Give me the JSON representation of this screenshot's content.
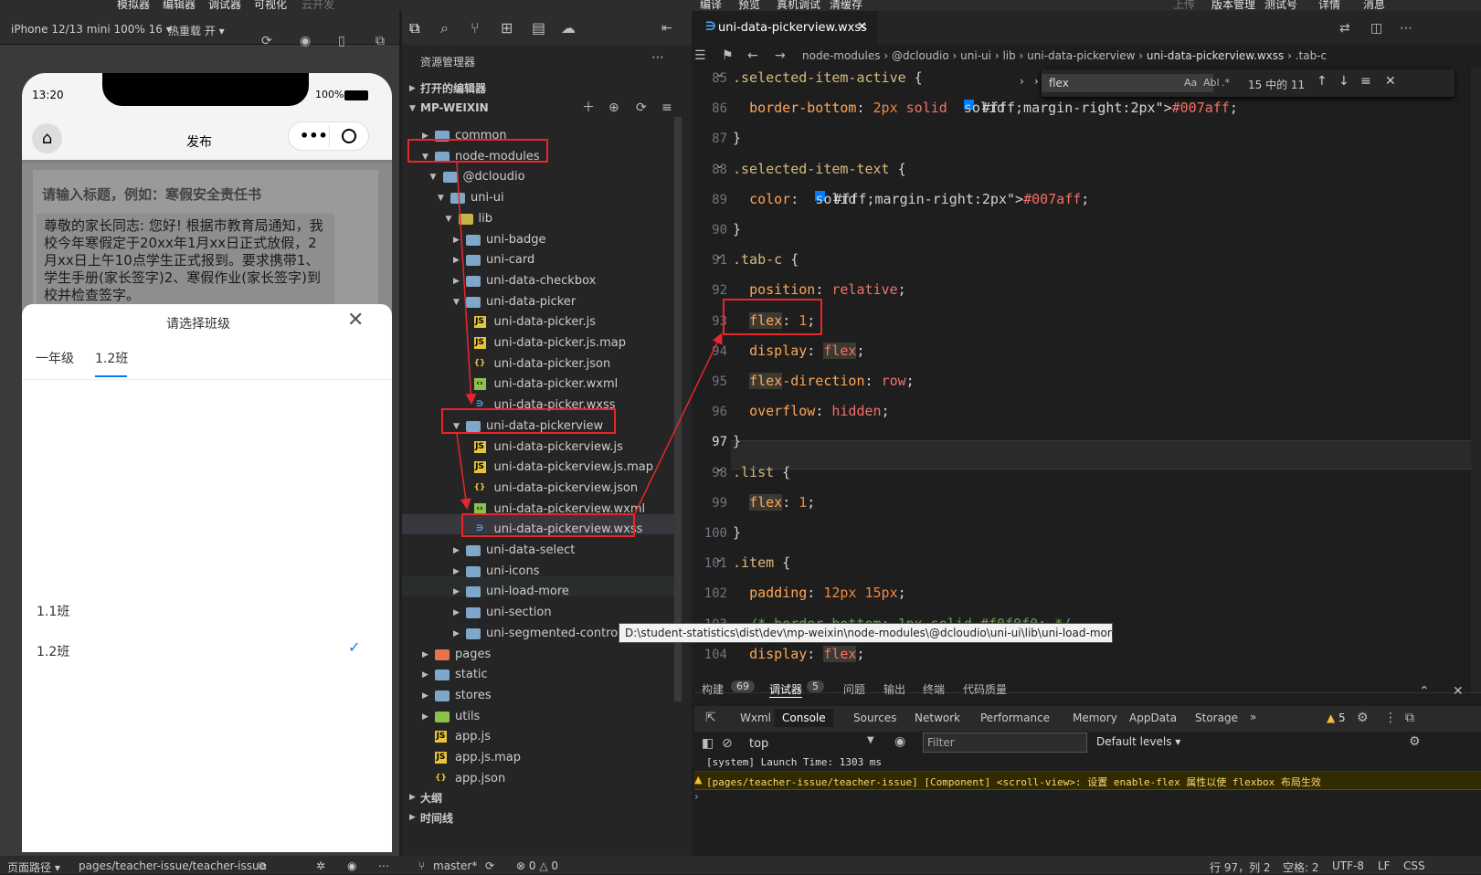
{
  "top_menu": {
    "items": [
      "模拟器",
      "编辑器",
      "调试器",
      "可视化",
      "云开发",
      "编译",
      "预览",
      "真机调试",
      "清缓存",
      "上传",
      "版本管理",
      "测试号",
      "详情",
      "消息"
    ]
  },
  "simulator": {
    "device": "iPhone 12/13 mini 100% 16 ▾",
    "hot_reload": "热重载 开 ▾",
    "time": "13:20",
    "battery": "100%",
    "nav_title": "发布",
    "page_title_placeholder": "请输入标题，例如：寒假安全责任书",
    "page_body": "尊敬的家长同志: 您好! 根据市教育局通知，我校今年寒假定于20xx年1月xx日正式放假，2月xx日上午10点学生正式报到。要求携带1、学生手册(家长签字)2、寒假作业(家长签字)到校并检查签字。",
    "sheet_title": "请选择班级",
    "tabs": [
      "一年级",
      "1.2班"
    ],
    "options": [
      "1.1班",
      "1.2班"
    ],
    "selected_option": "1.2班"
  },
  "explorer": {
    "title": "资源管理器",
    "open_editors": "打开的编辑器",
    "root": "MP-WEIXIN",
    "outline": "大纲",
    "timeline": "时间线",
    "tree": [
      {
        "label": "common",
        "type": "folder"
      },
      {
        "label": "node-modules",
        "type": "folder"
      },
      {
        "label": "@dcloudio",
        "type": "folder"
      },
      {
        "label": "uni-ui",
        "type": "folder"
      },
      {
        "label": "lib",
        "type": "folder"
      },
      {
        "label": "uni-badge",
        "type": "folder"
      },
      {
        "label": "uni-card",
        "type": "folder"
      },
      {
        "label": "uni-data-checkbox",
        "type": "folder"
      },
      {
        "label": "uni-data-picker",
        "type": "folder"
      },
      {
        "label": "uni-data-picker.js",
        "type": "js"
      },
      {
        "label": "uni-data-picker.js.map",
        "type": "js"
      },
      {
        "label": "uni-data-picker.json",
        "type": "json"
      },
      {
        "label": "uni-data-picker.wxml",
        "type": "wxml"
      },
      {
        "label": "uni-data-picker.wxss",
        "type": "css"
      },
      {
        "label": "uni-data-pickerview",
        "type": "folder"
      },
      {
        "label": "uni-data-pickerview.js",
        "type": "js"
      },
      {
        "label": "uni-data-pickerview.js.map",
        "type": "js"
      },
      {
        "label": "uni-data-pickerview.json",
        "type": "json"
      },
      {
        "label": "uni-data-pickerview.wxml",
        "type": "wxml"
      },
      {
        "label": "uni-data-pickerview.wxss",
        "type": "css"
      },
      {
        "label": "uni-data-select",
        "type": "folder"
      },
      {
        "label": "uni-icons",
        "type": "folder"
      },
      {
        "label": "uni-load-more",
        "type": "folder"
      },
      {
        "label": "uni-section",
        "type": "folder"
      },
      {
        "label": "uni-segmented-control",
        "type": "folder"
      },
      {
        "label": "pages",
        "type": "folder"
      },
      {
        "label": "static",
        "type": "folder"
      },
      {
        "label": "stores",
        "type": "folder"
      },
      {
        "label": "utils",
        "type": "folder"
      },
      {
        "label": "app.js",
        "type": "js"
      },
      {
        "label": "app.js.map",
        "type": "js"
      },
      {
        "label": "app.json",
        "type": "json"
      }
    ],
    "tooltip": "D:\\student-statistics\\dist\\dev\\mp-weixin\\node-modules\\@dcloudio\\uni-ui\\lib\\uni-load-more"
  },
  "editor": {
    "tab": "uni-data-pickerview.wxss",
    "breadcrumb": [
      "node-modules",
      "@dcloudio",
      "uni-ui",
      "lib",
      "uni-data-pickerview",
      "uni-data-pickerview.wxss",
      ".tab-c"
    ],
    "find": {
      "query": "flex",
      "count": "15 中的 11",
      "opts": [
        "Aa",
        "Abl",
        ".*"
      ]
    },
    "lines": [
      {
        "n": "85",
        "t": ".selected-item-active {"
      },
      {
        "n": "86",
        "t": "  border-bottom: 2px solid  #007aff;"
      },
      {
        "n": "87",
        "t": "}"
      },
      {
        "n": "88",
        "t": ".selected-item-text {"
      },
      {
        "n": "89",
        "t": "  color:  #007aff;"
      },
      {
        "n": "90",
        "t": "}"
      },
      {
        "n": "91",
        "t": ".tab-c {"
      },
      {
        "n": "92",
        "t": "  position: relative;"
      },
      {
        "n": "93",
        "t": "  flex: 1;"
      },
      {
        "n": "94",
        "t": "  display: flex;"
      },
      {
        "n": "95",
        "t": "  flex-direction: row;"
      },
      {
        "n": "96",
        "t": "  overflow: hidden;"
      },
      {
        "n": "97",
        "t": "}"
      },
      {
        "n": "98",
        "t": ".list {"
      },
      {
        "n": "99",
        "t": "  flex: 1;"
      },
      {
        "n": "100",
        "t": "}"
      },
      {
        "n": "101",
        "t": ".item {"
      },
      {
        "n": "102",
        "t": "  padding: 12px 15px;"
      },
      {
        "n": "103",
        "t": "  /* border-bottom: 1px solid #f0f0f0; */"
      },
      {
        "n": "104",
        "t": "  display: flex;"
      }
    ],
    "swatch_color": "#007aff"
  },
  "panel": {
    "tabs": [
      "构建",
      "调试器",
      "问题",
      "输出",
      "终端",
      "代码质量"
    ],
    "badges": {
      "build": "69",
      "debugger": "5"
    },
    "devtabs": [
      "Wxml",
      "Console",
      "Sources",
      "Network",
      "Performance",
      "Memory",
      "AppData",
      "Storage"
    ],
    "warn_count": "5",
    "context": "top",
    "filter_placeholder": "Filter",
    "levels": "Default levels ▾",
    "log1": "[system] Launch Time: 1303 ms",
    "log2": "[pages/teacher-issue/teacher-issue] [Component] <scroll-view>: 设置 enable-flex 属性以使 flexbox 布局生效"
  },
  "status": {
    "page_path_label": "页面路径 ▾",
    "page_path": "pages/teacher-issue/teacher-issue",
    "branch": "master*",
    "errors": "⊗ 0 △ 0",
    "cursor": "行 97，列 2",
    "spaces": "空格: 2",
    "encoding": "UTF-8",
    "eol": "LF",
    "lang": "CSS"
  },
  "colors": {
    "accent": "#007aff",
    "annotation": "#e8262b"
  }
}
